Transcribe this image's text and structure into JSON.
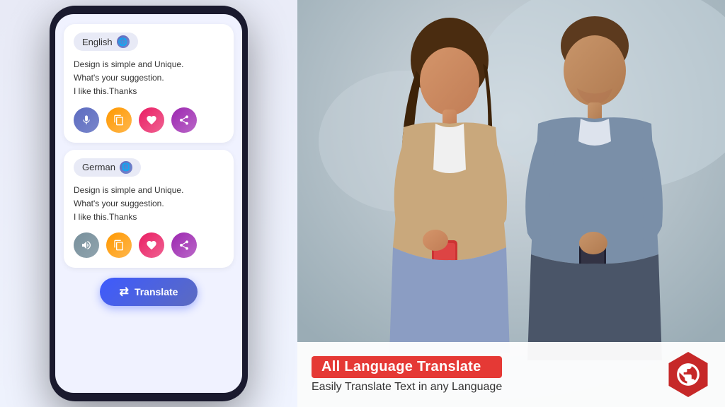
{
  "app": {
    "title": "All Language Translate"
  },
  "phone": {
    "source_card": {
      "language": "English",
      "text_line1": "Design is simple and Unique.",
      "text_line2": "What's your suggestion.",
      "text_line3": "I like this.Thanks"
    },
    "target_card": {
      "language": "German",
      "text_line1": "Design is simple and Unique.",
      "text_line2": "What's your suggestion.",
      "text_line3": "I like this.Thanks"
    },
    "translate_button": "Translate",
    "action_buttons": {
      "mic": "🎤",
      "copy": "📋",
      "heart": "❤",
      "share": "◁"
    }
  },
  "banner": {
    "title": "All Language Translate",
    "subtitle": "Easily Translate Text in any  Language",
    "icon": "🌐"
  },
  "colors": {
    "accent_blue": "#3d5afe",
    "accent_red": "#e53935",
    "card_bg": "#ffffff",
    "screen_bg": "#f0f2ff",
    "phone_body": "#1a1a2e"
  }
}
